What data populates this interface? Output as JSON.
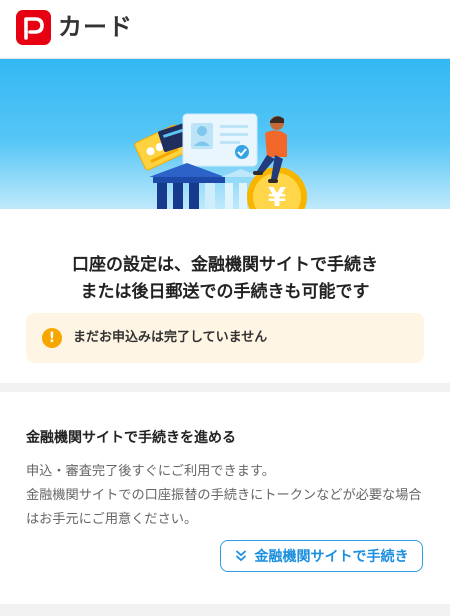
{
  "header": {
    "app_title": "カード",
    "logo_icon": "paypay-logo-icon"
  },
  "hero": {
    "illustration": "bank-card-coin-illustration"
  },
  "setup": {
    "title_line1": "口座の設定は、金融機関サイトで手続き",
    "title_line2": "または後日郵送での手続きも可能です"
  },
  "notice": {
    "icon": "exclamation-icon",
    "text": "まだお申込みは完了していません"
  },
  "section": {
    "heading": "金融機関サイトで手続きを進める",
    "body_line1": "申込・審査完了後すぐにご利用できます。",
    "body_line2": "金融機関サイトでの口座振替の手続きにトークンなどが必要な場合はお手元にご用意ください。",
    "button_label": "金融機関サイトで手続き",
    "button_icon": "double-chevron-down-icon"
  },
  "colors": {
    "brand_red": "#e60012",
    "hero_blue": "#33b8f3",
    "link_blue": "#1b8fe0",
    "notice_bg": "#fff5e4",
    "notice_icon": "#f7a600"
  }
}
